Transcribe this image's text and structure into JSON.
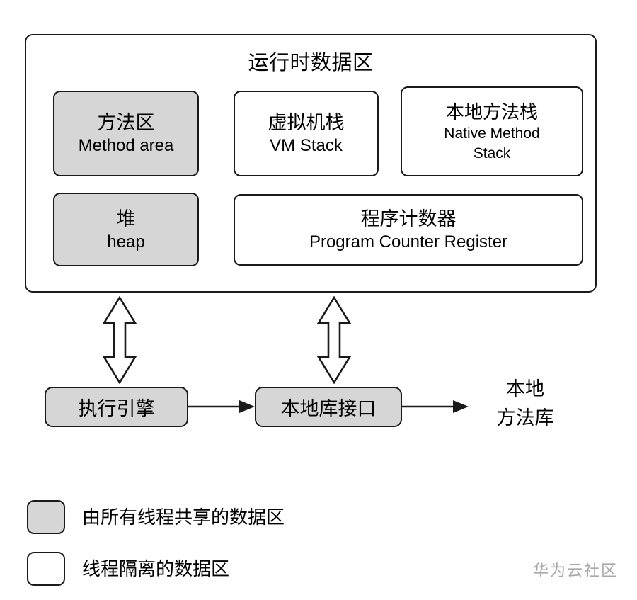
{
  "diagram": {
    "title": "运行时数据区",
    "watermark": "华为云社区",
    "colors": {
      "shared_fill": "#d6d6d6",
      "isolated_fill": "#ffffff",
      "stroke": "#1a1a1a",
      "watermark": "#a8a8a8"
    }
  },
  "runtime_area": {
    "title": "运行时数据区",
    "boxes": [
      {
        "cn": "方法区",
        "en": "Method area",
        "fill": "shared"
      },
      {
        "cn": "虚拟机栈",
        "en": "VM Stack",
        "fill": "isolated"
      },
      {
        "cn": "本地方法栈",
        "en": "Native Method Stack",
        "fill": "isolated"
      },
      {
        "cn": "堆",
        "en": "heap",
        "fill": "shared"
      },
      {
        "cn": "程序计数器",
        "en": "Program Counter Register",
        "fill": "isolated"
      }
    ]
  },
  "bottom_row": {
    "exec_engine": "执行引擎",
    "native_interface": "本地库接口",
    "native_library_line1": "本地",
    "native_library_line2": "方法库"
  },
  "legend": {
    "shared_label": "由所有线程共享的数据区",
    "isolated_label": "线程隔离的数据区"
  }
}
